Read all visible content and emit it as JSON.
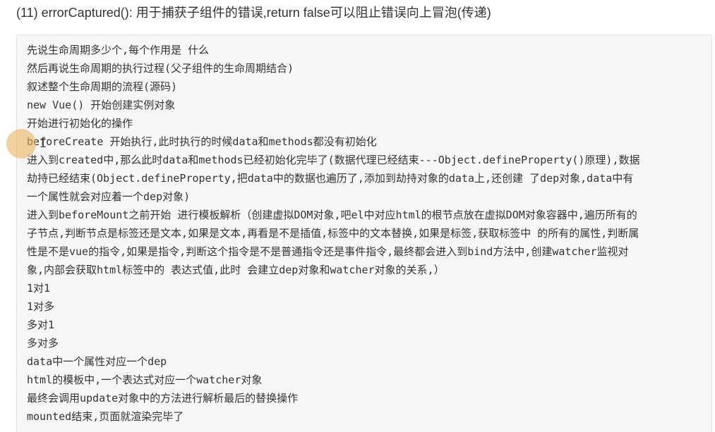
{
  "heading": "(11) errorCaptured(): 用于捕获子组件的错误,return false可以阻止错误向上冒泡(传递)",
  "lines": [
    "先说生命周期多少个,每个作用是 什么",
    "然后再说生命周期的执行过程(父子组件的生命周期结合)",
    "叙述整个生命周期的流程(源码)",
    "new Vue() 开始创建实例对象",
    "开始进行初始化的操作",
    "beforeCreate 开始执行,此时执行的时候data和methods都没有初始化",
    "进入到created中,那么此时data和methods已经初始化完毕了(数据代理已经结束---Object.defineProperty()原理),数据",
    "劫持已经结束(Object.defineProperty,把data中的数据也遍历了,添加到劫持对象的data上,还创建 了dep对象,data中有",
    "一个属性就会对应着一个dep对象)",
    "进入到beforeMount之前开始 进行模板解析（创建虚拟DOM对象,吧el中对应html的根节点放在虚拟DOM对象容器中,遍历所有的",
    "子节点,判断节点是标签还是文本,如果是文本,再看是不是插值,标签中的文本替换,如果是标签,获取标签中 的所有的属性,判断属",
    "性是不是vue的指令,如果是指令,判断这个指令是不是普通指令还是事件指令,最终都会进入到bind方法中,创建watcher监视对",
    "象,内部会获取html标签中的 表达式值,此时 会建立dep对象和watcher对象的关系,）",
    "1对1",
    "1对多",
    "多对1",
    "多对多",
    "data中一个属性对应一个dep",
    "html的模板中,一个表达式对应一个watcher对象",
    "最终会调用update对象中的方法进行解析最后的替换操作",
    "mounted结束,页面就渲染完毕了"
  ]
}
